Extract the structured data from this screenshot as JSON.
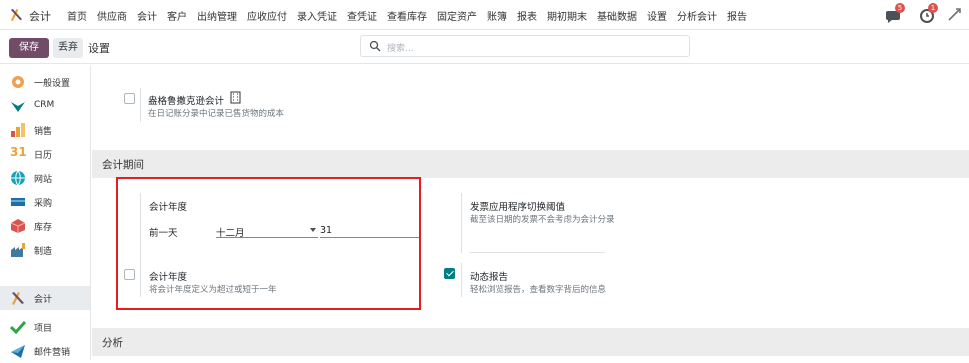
{
  "topbar": {
    "app_name": "会计",
    "menu": [
      "首页",
      "供应商",
      "会计",
      "客户",
      "出纳管理",
      "应收应付",
      "录入凭证",
      "查凭证",
      "查看库存",
      "固定资产",
      "账簿",
      "报表",
      "期初期末",
      "基础数据",
      "设置",
      "分析会计",
      "报告"
    ],
    "messages_count": "5",
    "activities_count": "1"
  },
  "controls": {
    "save_label": "保存",
    "discard_label": "丢弃",
    "breadcrumb": "设置",
    "search_placeholder": "搜索..."
  },
  "sidebar": {
    "items": [
      {
        "label": "一般设置",
        "icon": "general-settings-icon",
        "color": "#f0a04b"
      },
      {
        "label": "CRM",
        "icon": "crm-icon",
        "color": "#017e84"
      },
      {
        "label": "销售",
        "icon": "sales-icon",
        "color": "#e8a33b"
      },
      {
        "label": "日历",
        "icon": "calendar-icon",
        "color": "#e8a33b"
      },
      {
        "label": "网站",
        "icon": "website-icon",
        "color": "#17a2b8"
      },
      {
        "label": "采购",
        "icon": "purchase-icon",
        "color": "#1e6fa8"
      },
      {
        "label": "库存",
        "icon": "inventory-icon",
        "color": "#d9534f"
      },
      {
        "label": "制造",
        "icon": "manufacturing-icon",
        "color": "#3d7c9e"
      },
      {
        "label": "会计",
        "icon": "accounting-icon",
        "color": "#e8a33b"
      },
      {
        "label": "项目",
        "icon": "project-icon",
        "color": "#28a745"
      },
      {
        "label": "邮件营销",
        "icon": "email-marketing-icon",
        "color": "#1e6fa8"
      }
    ],
    "active_label": "会计",
    "calendar_number": "31"
  },
  "content": {
    "anglo_title": "盎格鲁撒克逊会计",
    "anglo_desc": "在日记账分录中记录已售货物的成本",
    "period_section": "会计期间",
    "fiscal_year_title": "会计年度",
    "last_day_label": "前一天",
    "month_value": "十二月",
    "day_value": "31",
    "fiscal_years_title": "会计年度",
    "fiscal_years_desc": "将会计年度定义为超过或短于一年",
    "invoicing_switch_title": "发票应用程序切换阈值",
    "invoicing_switch_desc": "截至该日期的发票不会考虑为会计分录",
    "dynamic_reports_title": "动态报告",
    "dynamic_reports_desc": "轻松浏览报告，查看数字背后的信息",
    "analytics_section": "分析"
  },
  "colors": {
    "brand": "#714b67",
    "highlight": "#e51d1d",
    "checkbox_checked": "#017e84"
  }
}
